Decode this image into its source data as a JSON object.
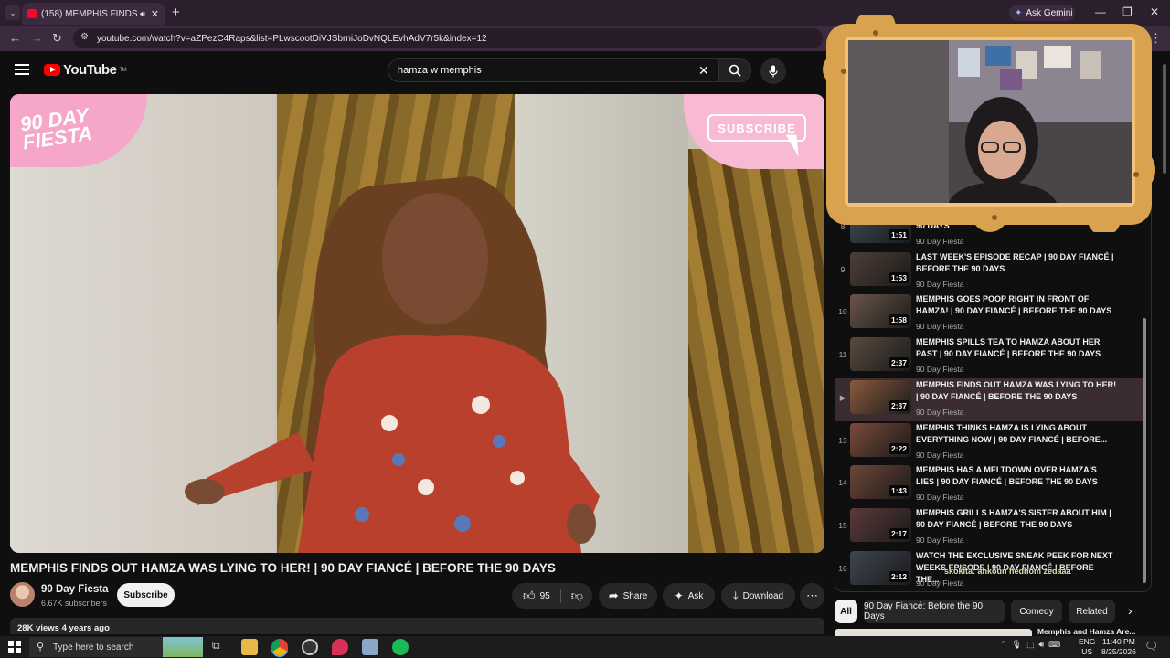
{
  "browser": {
    "tab_title": "(158) MEMPHIS FINDS OUT",
    "new_tab": "+",
    "gemini": "Ask Gemini",
    "url": "youtube.com/watch?v=aZPezC4Raps&list=PLwscootDiVJSbrniJoDvNQLEvhAdV7r5k&index=12"
  },
  "youtube": {
    "logo": "YouTube",
    "logo_tm": "TM",
    "search_value": "hamza w memphis"
  },
  "video": {
    "overlay_brand": "90 DAY FIESTA",
    "overlay_subscribe": "SUBSCRIBE",
    "title": "MEMPHIS FINDS OUT HAMZA WAS LYING TO HER! | 90 DAY FIANCÉ | BEFORE THE 90 DAYS",
    "channel": "90 Day Fiesta",
    "subscribers": "6.67K subscribers",
    "subscribe_label": "Subscribe",
    "likes": "95",
    "share": "Share",
    "ask": "Ask",
    "download": "Download",
    "meta": "28K views  4 years ago"
  },
  "playlist": {
    "items": [
      {
        "index": "8",
        "title": "HAMZA'S MOM ... | 90 DAY FIANCÉ | BEFORE THE 90 DAYS",
        "channel": "90 Day Fiesta",
        "duration": "1:51",
        "thumb": "#3d4a55"
      },
      {
        "index": "9",
        "title": "LAST WEEK'S EPISODE RECAP | 90 DAY FIANCÉ | BEFORE THE 90 DAYS",
        "channel": "90 Day Fiesta",
        "duration": "1:53",
        "thumb": "#4e3f36"
      },
      {
        "index": "10",
        "title": "MEMPHIS GOES POOP RIGHT IN FRONT OF HAMZA! | 90 DAY FIANCÉ | BEFORE THE 90 DAYS",
        "channel": "90 Day Fiesta",
        "duration": "1:58",
        "thumb": "#6b5648"
      },
      {
        "index": "11",
        "title": "MEMPHIS SPILLS TEA TO HAMZA ABOUT HER PAST | 90 DAY FIANCÉ | BEFORE THE 90 DAYS",
        "channel": "90 Day Fiesta",
        "duration": "2:37",
        "thumb": "#5a4a3d"
      },
      {
        "index": "▶",
        "title": "MEMPHIS FINDS OUT HAMZA WAS LYING TO HER! | 90 DAY FIANCÉ | BEFORE THE 90 DAYS",
        "channel": "90 Day Fiesta",
        "duration": "2:37",
        "thumb": "#8a5a3e",
        "active": true
      },
      {
        "index": "13",
        "title": "MEMPHIS THINKS HAMZA IS LYING ABOUT EVERYTHING NOW | 90 DAY FIANCÉ | BEFORE...",
        "channel": "90 Day Fiesta",
        "duration": "2:22",
        "thumb": "#7a4b3a"
      },
      {
        "index": "14",
        "title": "MEMPHIS HAS A MELTDOWN OVER HAMZA'S LIES | 90 DAY FIANCÉ | BEFORE THE 90 DAYS",
        "channel": "90 Day Fiesta",
        "duration": "1:43",
        "thumb": "#6e4637"
      },
      {
        "index": "15",
        "title": "MEMPHIS GRILLS HAMZA'S SISTER ABOUT HIM | 90 DAY FIANCÉ | BEFORE THE 90 DAYS",
        "channel": "90 Day Fiesta",
        "duration": "2:17",
        "thumb": "#5b3a3a"
      },
      {
        "index": "16",
        "title": "WATCH THE EXCLUSIVE SNEAK PEEK FOR NEXT WEEKS EPISODE | 90 DAY FIANCÉ | BEFORE THE...",
        "channel": "90 Day Fiesta",
        "duration": "2:12",
        "thumb": "#3f4650"
      }
    ],
    "overlay_text": "skokita: ahkoun hedhom zedaaa"
  },
  "chips": [
    "All",
    "90 Day Fiancé: Before the 90 Days",
    "Comedy",
    "Related"
  ],
  "rec_peek_title": "Memphis and Hamza Are...",
  "taskbar": {
    "search_placeholder": "Type here to search",
    "lang_top": "ENG",
    "lang_bottom": "US",
    "time": "11:40 PM",
    "date": "8/25/2026"
  },
  "colors": {
    "bg": "#0f0f0f",
    "brand_red": "#ff0000",
    "cam_frame": "#d9a24f"
  }
}
